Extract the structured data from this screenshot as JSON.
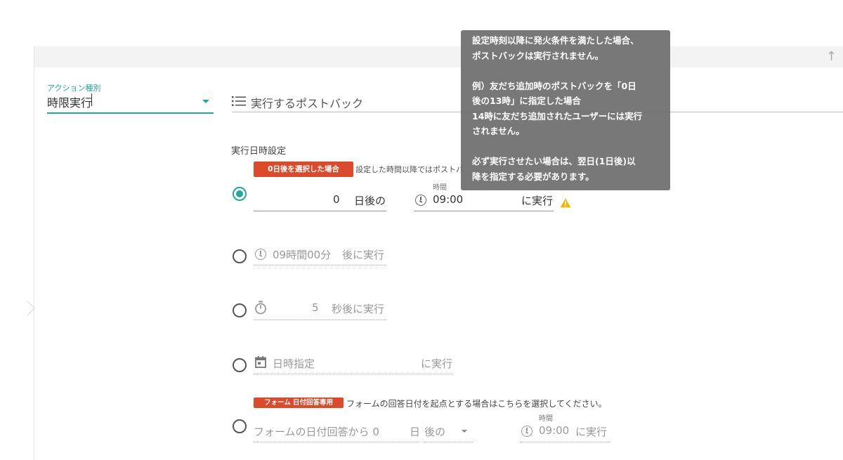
{
  "action": {
    "label": "アクション種別",
    "value": "時限実行"
  },
  "postback": {
    "label": "実行するポストバック",
    "icon": "list-icon"
  },
  "schedule": {
    "title": "実行日時設定",
    "option1": {
      "badge": "0日後を選択した場合",
      "note": "設定した時間以降ではポストバ",
      "time_label": "時間",
      "days_value": "0",
      "days_suffix": "日後の",
      "time_value": "09:00",
      "exec_suffix": "に実行",
      "selected": true
    },
    "option2": {
      "text": "09時間00分",
      "suffix": "後に実行"
    },
    "option3": {
      "value": "5",
      "suffix": "秒後に実行"
    },
    "option4": {
      "text": "日時指定",
      "suffix": "に実行"
    },
    "option5": {
      "badge": "フォーム 日付回答専用",
      "note": "フォームの回答日付を起点とする場合はこちらを選択してください。",
      "prefix": "フォームの日付回答から 0",
      "day_unit": "日",
      "after": "後の",
      "time_label": "時間",
      "time_value": "09:00",
      "exec_suffix": "に実行"
    }
  },
  "tooltip": {
    "line1": "設定時刻以降に発火条件を満たした場合、",
    "line2": "ポストバックは実行されません。",
    "line3": "例）友だち追加時のポストバックを「0日",
    "line4": "後の13時」に指定した場合",
    "line5": "14時に友だち追加されたユーザーには実行",
    "line6": "されません。",
    "line7": "必ず実行させたい場合は、翌日(1日後)以",
    "line8": "降を指定する必要があります。"
  },
  "colors": {
    "accent": "#26a69a",
    "badge": "#db4a2b",
    "warning": "#f2b705",
    "tooltip_bg": "#6e6e6e"
  }
}
